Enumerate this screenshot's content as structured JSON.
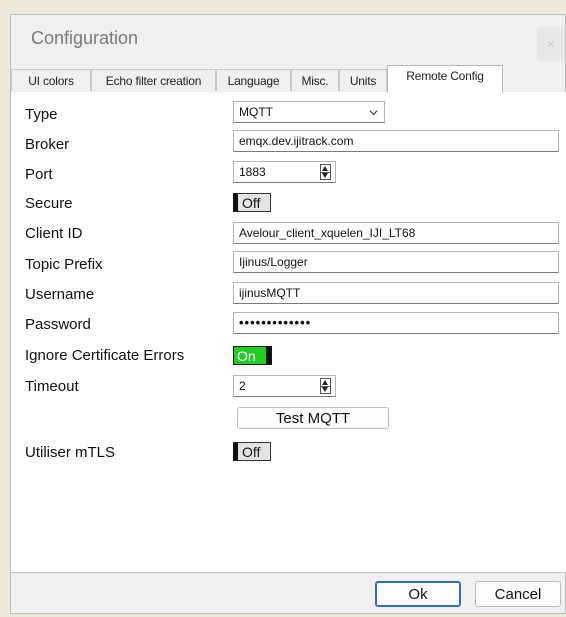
{
  "window": {
    "title": "Configuration",
    "close_glyph": "×"
  },
  "tabs": [
    {
      "label": "UI colors",
      "active": false
    },
    {
      "label": "Echo filter creation",
      "active": false
    },
    {
      "label": "Language",
      "active": false
    },
    {
      "label": "Misc.",
      "active": false
    },
    {
      "label": "Units",
      "active": false
    },
    {
      "label": "Remote Config",
      "active": true
    }
  ],
  "form": {
    "type": {
      "label": "Type",
      "value": "MQTT"
    },
    "broker": {
      "label": "Broker",
      "value": "emqx.dev.ijitrack.com"
    },
    "port": {
      "label": "Port",
      "value": "1883"
    },
    "secure": {
      "label": "Secure",
      "state": "Off"
    },
    "client_id": {
      "label": "Client ID",
      "value": "Avelour_client_xquelen_IJI_LT68"
    },
    "topic_prefix": {
      "label": "Topic Prefix",
      "value": "Ijinus/Logger"
    },
    "username": {
      "label": "Username",
      "value": "ijinusMQTT"
    },
    "password": {
      "label": "Password",
      "value": "•••••••••••••"
    },
    "ignore_cert": {
      "label": "Ignore Certificate Errors",
      "state": "On"
    },
    "timeout": {
      "label": "Timeout",
      "value": "2"
    },
    "test_button": "Test MQTT",
    "mtls": {
      "label": "Utiliser mTLS",
      "state": "Off"
    }
  },
  "footer": {
    "ok_label": "Ok",
    "cancel_label": "Cancel"
  },
  "colors": {
    "toggle_on": "#22cc22",
    "default_button_border": "#2f6ad0"
  }
}
